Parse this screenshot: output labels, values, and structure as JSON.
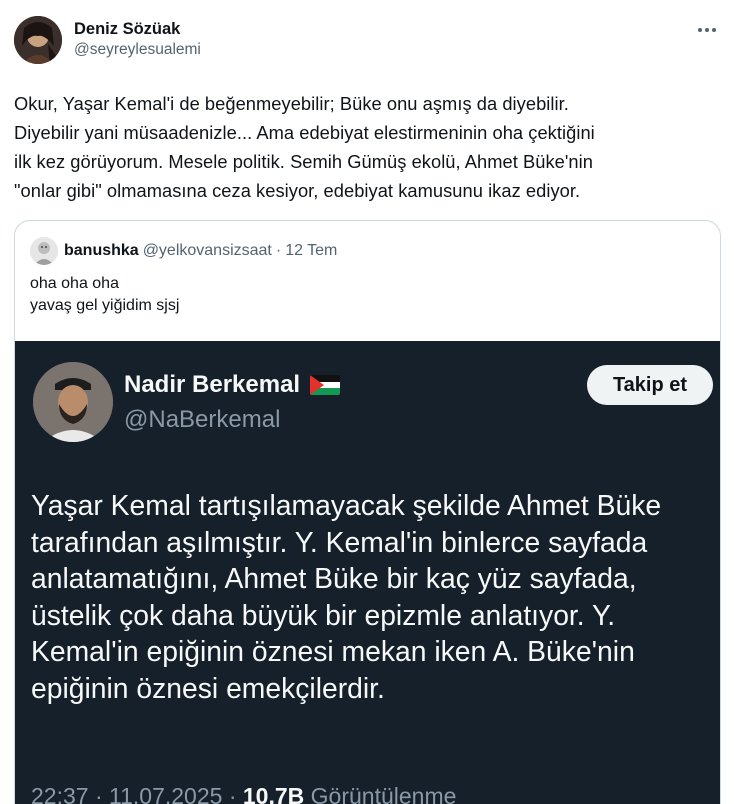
{
  "tweet": {
    "author_name": "Deniz Sözüak",
    "author_handle": "@seyreylesualemi",
    "text": "Okur, Yaşar Kemal'i de beğenmeyebilir; Büke onu aşmış da diyebilir.\nDiyebilir yani müsaadenizle... Ama edebiyat elestirmeninin oha çektiğini\nilk kez görüyorum. Mesele politik. Semih Gümüş ekolü, Ahmet Büke'nin\n\"onlar gibi\" olmamasına ceza kesiyor, edebiyat kamusunu ikaz ediyor.",
    "more_icon": "more-horizontal-icon"
  },
  "quote": {
    "name": "banushka",
    "handle": "@yelkovansizsaat",
    "separator": "·",
    "date": "12 Tem",
    "text": "oha oha oha\nyavaş gel yiğidim sjsj"
  },
  "embedded": {
    "name": "Nadir Berkemal",
    "flag_icon": "palestine-flag-icon",
    "handle": "@NaBerkemal",
    "follow_label": "Takip et",
    "text": "Yaşar Kemal tartışılamayacak şekilde Ahmet Büke\ntarafından aşılmıştır. Y. Kemal'in binlerce sayfada\nanlatamatığını, Ahmet Büke bir kaç yüz sayfada,\nüstelik çok daha büyük bir epizmle anlatıyor. Y.\nKemal'in epiğinin öznesi mekan iken A. Büke'nin\nepiğinin öznesi emekçilerdir.",
    "time": "22:37",
    "separator": "·",
    "date": "11.07.2025",
    "views": "10,7B",
    "views_label": "Görüntülenme"
  },
  "colors": {
    "text_primary": "#0f1419",
    "text_secondary": "#536471",
    "border": "#cfd9de",
    "dark_bg": "#15202b",
    "dark_text": "#f7f9f9",
    "dark_muted": "#8b98a5"
  }
}
